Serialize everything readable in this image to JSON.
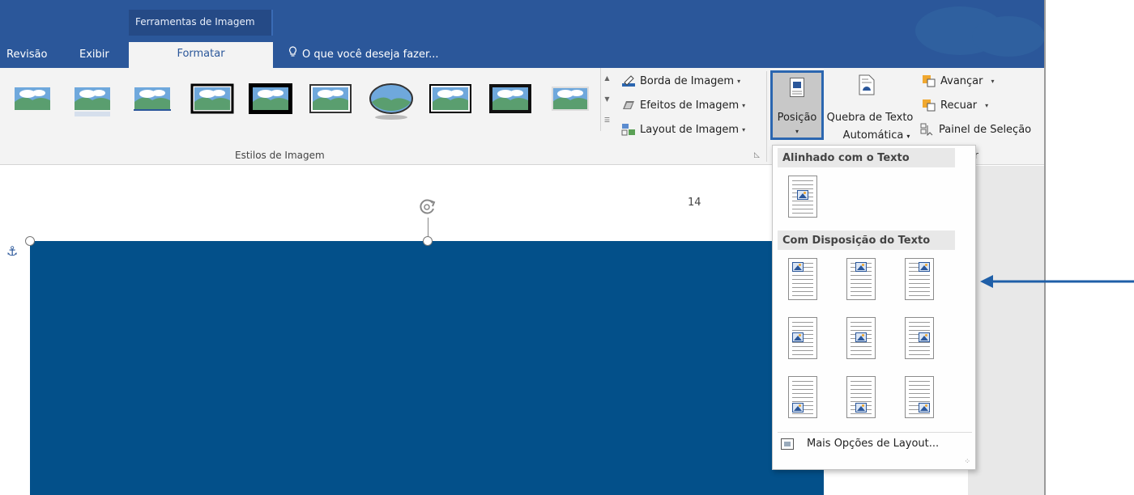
{
  "header": {
    "context_tab_label": "Ferramentas de Imagem",
    "tabs": [
      "Revisão",
      "Exibir",
      "Formatar"
    ],
    "tell_me": "O que você deseja fazer..."
  },
  "ribbon": {
    "picture_styles_group_label": "Estilos de Imagem",
    "commands": {
      "border": "Borda de Imagem",
      "effects": "Efeitos de Imagem",
      "layout": "Layout de Imagem",
      "position": "Posição",
      "wrap_line1": "Quebra de Texto",
      "wrap_line2": "Automática",
      "bring_forward": "Avançar",
      "send_backward": "Recuar",
      "selection_pane": "Painel de Seleção"
    },
    "partial_group_label": "r"
  },
  "document": {
    "page_number": "14"
  },
  "position_menu": {
    "section_inline": "Alinhado com o Texto",
    "section_wrap": "Com Disposição do Texto",
    "more_options": "Mais Opções de Layout..."
  },
  "colors": {
    "title_bar": "#2b579a",
    "ribbon": "#f3f3f3",
    "image_fill": "#03508a",
    "arrow": "#1f5fa8",
    "position_highlight": "#2b66b0"
  }
}
